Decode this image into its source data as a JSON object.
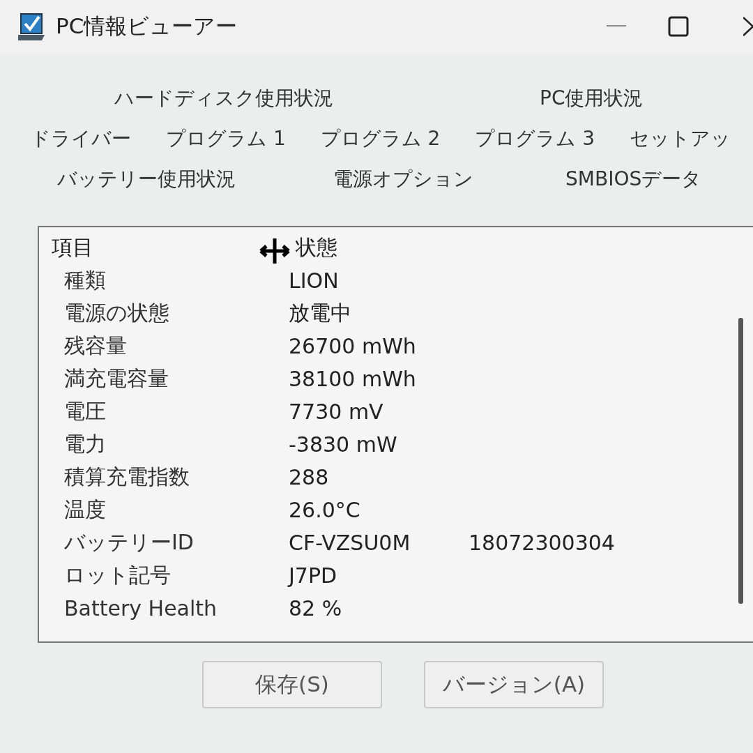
{
  "window": {
    "title": "PC情報ビューアー"
  },
  "tab_rows": [
    [
      {
        "label": "ハードディスク使用状況"
      },
      {
        "label": "PC使用状況"
      }
    ],
    [
      {
        "label": "ドライバー"
      },
      {
        "label": "プログラム 1"
      },
      {
        "label": "プログラム 2"
      },
      {
        "label": "プログラム 3"
      },
      {
        "label": "セットアッ"
      }
    ],
    [
      {
        "label": "バッテリー使用状況"
      },
      {
        "label": "電源オプション"
      },
      {
        "label": "SMBIOSデータ"
      }
    ]
  ],
  "table": {
    "columns": [
      "項目",
      "状態"
    ],
    "rows": [
      {
        "item": "種類",
        "value": "LION"
      },
      {
        "item": "電源の状態",
        "value": "放電中"
      },
      {
        "item": "残容量",
        "value": "26700 mWh"
      },
      {
        "item": "満充電容量",
        "value": "38100 mWh"
      },
      {
        "item": "電圧",
        "value": "7730 mV"
      },
      {
        "item": "電力",
        "value": "-3830 mW"
      },
      {
        "item": "積算充電指数",
        "value": "288"
      },
      {
        "item": "温度",
        "value": "26.0°C"
      },
      {
        "item": "バッテリーID",
        "value": "CF-VZSU0M",
        "value_2": "18072300304"
      },
      {
        "item": "ロット記号",
        "value": "J7PD"
      },
      {
        "item": "Battery Health",
        "value": "82 %"
      }
    ]
  },
  "buttons": [
    "保存(S)",
    "バージョン(A)"
  ]
}
